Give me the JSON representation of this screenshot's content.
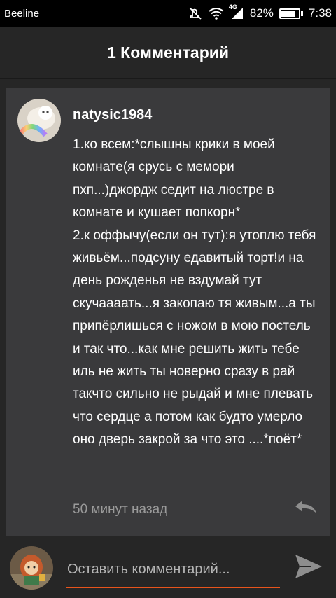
{
  "status_bar": {
    "carrier": "Beeline",
    "network": "4G",
    "battery_percent": "82%",
    "battery_level": 0.82,
    "time": "7:38",
    "icons": [
      "mute-icon",
      "wifi-icon",
      "signal-icon",
      "battery-icon"
    ]
  },
  "header": {
    "title": "1 Комментарий"
  },
  "comment": {
    "username": "natysic1984",
    "text": "1.ко всем:*слышны крики в моей комнате(я срусь с мемори пхп...)джордж седит на люстре в комнате и кушает попкорн*\n2.к оффычу(если он тут):я утоплю тебя живьём...подсуну едавитый торт!и на день рожденья не вздумай тут скучаааать...я закопаю тя живым...а ты припёрлишься с ножом в мою постель и так что...как мне решить жить тебе иль не жить ты новерно сразу в рай такчто сильно не рыдай и мне плевать что сердце а потом как будто умерло оно дверь закрой за что это ....*поёт*",
    "time_ago": "50 минут назад"
  },
  "composer": {
    "placeholder": "Оставить комментарий..."
  },
  "colors": {
    "background": "#262626",
    "card": "#3a3a3c",
    "accent": "#e8541c",
    "muted_text": "#9a9a9a",
    "status_bar": "#000000"
  }
}
